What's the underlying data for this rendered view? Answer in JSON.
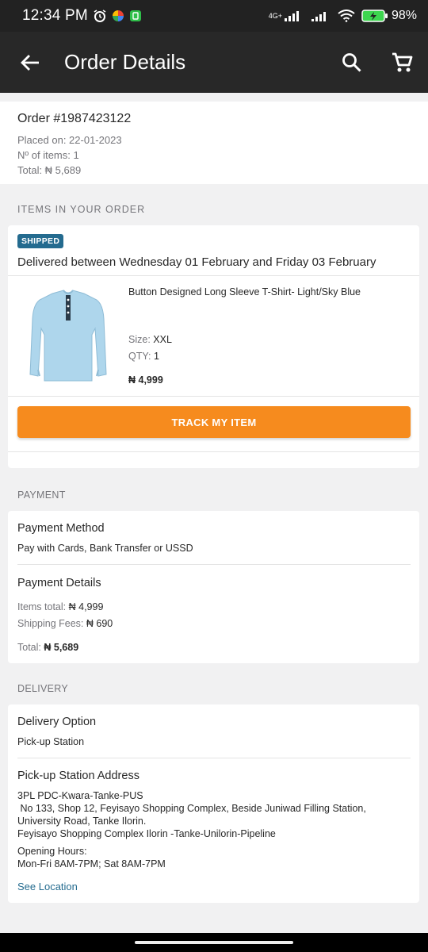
{
  "status": {
    "time": "12:34 PM",
    "network": "4G+",
    "battery": "98%"
  },
  "appbar": {
    "title": "Order Details"
  },
  "order": {
    "number": "Order #1987423122",
    "placed": "Placed on: 22-01-2023",
    "items": "Nº of items: 1",
    "total": "Total: ₦ 5,689"
  },
  "items_section": {
    "label": "ITEMS IN YOUR ORDER",
    "badge": "SHIPPED",
    "delivery_window": "Delivered between Wednesday 01 February and Friday 03 February",
    "product": {
      "name": "Button Designed Long Sleeve T-Shirt- Light/Sky Blue",
      "size_label": "Size:",
      "size": "XXL",
      "qty_label": "QTY:",
      "qty": "1",
      "price": "₦ 4,999"
    },
    "track_button": "TRACK MY ITEM"
  },
  "payment": {
    "label": "PAYMENT",
    "method_title": "Payment Method",
    "method": "Pay with Cards, Bank Transfer or USSD",
    "details_title": "Payment Details",
    "items_total_label": "Items total:",
    "items_total": "₦ 4,999",
    "shipping_label": "Shipping Fees:",
    "shipping": "₦ 690",
    "total_label": "Total:",
    "total": "₦ 5,689"
  },
  "delivery": {
    "label": "DELIVERY",
    "option_title": "Delivery Option",
    "option": "Pick-up Station",
    "address_title": "Pick-up Station Address",
    "address_line1": "3PL PDC-Kwara-Tanke-PUS",
    "address_line2": " No 133, Shop 12, Feyisayo Shopping Complex, Beside Juniwad Filling Station,",
    "address_line3": "University Road, Tanke Ilorin.",
    "address_line4": "Feyisayo Shopping Complex Ilorin -Tanke-Unilorin-Pipeline",
    "hours_label": "Opening Hours:",
    "hours": "Mon-Fri 8AM-7PM; Sat 8AM-7PM",
    "see_location": "See Location"
  },
  "colors": {
    "accent": "#f68b1e",
    "appbar": "#282828",
    "badge": "#246b8f",
    "link": "#246b8f"
  }
}
